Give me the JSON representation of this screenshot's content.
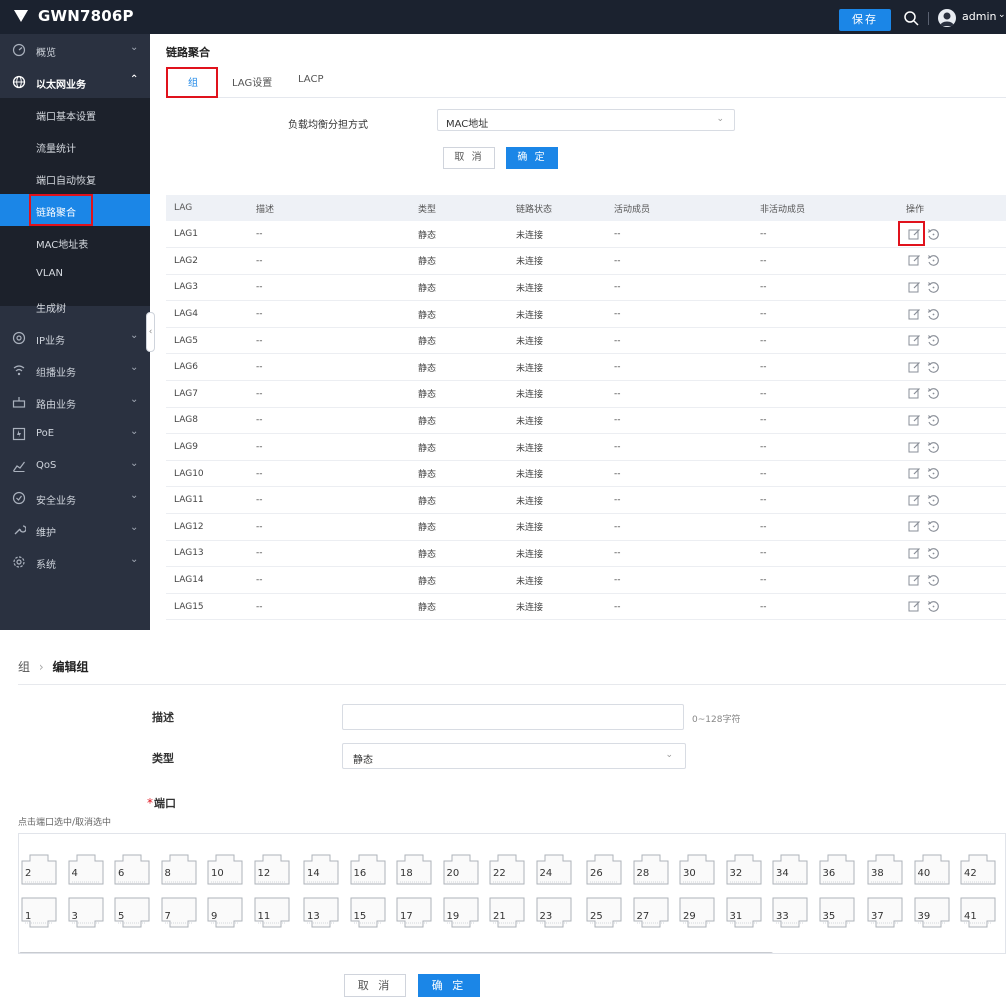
{
  "app": {
    "title": "GWN7806P",
    "save_label": "保存",
    "user": "admin"
  },
  "sidebar": {
    "items": [
      {
        "label": "概览",
        "icon": "dashboard-icon"
      },
      {
        "label": "以太网业务",
        "icon": "globe-icon"
      },
      {
        "label": "IP业务",
        "icon": "location-icon"
      },
      {
        "label": "组播业务",
        "icon": "multicast-icon"
      },
      {
        "label": "路由业务",
        "icon": "route-icon"
      },
      {
        "label": "PoE",
        "icon": "poe-icon"
      },
      {
        "label": "QoS",
        "icon": "chart-icon"
      },
      {
        "label": "安全业务",
        "icon": "shield-icon"
      },
      {
        "label": "维护",
        "icon": "wrench-icon"
      },
      {
        "label": "系统",
        "icon": "gear-icon"
      }
    ],
    "subitems": [
      "端口基本设置",
      "流量统计",
      "端口自动恢复",
      "链路聚合",
      "MAC地址表",
      "VLAN",
      "生成树"
    ],
    "active_subitem": "链路聚合"
  },
  "main": {
    "title": "链路聚合",
    "tabs": [
      "组",
      "LAG设置",
      "LACP"
    ],
    "active_tab": "组",
    "load_balance": {
      "label": "负载均衡分担方式",
      "value": "MAC地址"
    },
    "cancel_label": "取 消",
    "ok_label": "确 定"
  },
  "table": {
    "headers": [
      "LAG",
      "描述",
      "类型",
      "链路状态",
      "活动成员",
      "非活动成员",
      "操作"
    ],
    "rows": [
      [
        "LAG1",
        "--",
        "静态",
        "未连接",
        "--",
        "--"
      ],
      [
        "LAG2",
        "--",
        "静态",
        "未连接",
        "--",
        "--"
      ],
      [
        "LAG3",
        "--",
        "静态",
        "未连接",
        "--",
        "--"
      ],
      [
        "LAG4",
        "--",
        "静态",
        "未连接",
        "--",
        "--"
      ],
      [
        "LAG5",
        "--",
        "静态",
        "未连接",
        "--",
        "--"
      ],
      [
        "LAG6",
        "--",
        "静态",
        "未连接",
        "--",
        "--"
      ],
      [
        "LAG7",
        "--",
        "静态",
        "未连接",
        "--",
        "--"
      ],
      [
        "LAG8",
        "--",
        "静态",
        "未连接",
        "--",
        "--"
      ],
      [
        "LAG9",
        "--",
        "静态",
        "未连接",
        "--",
        "--"
      ],
      [
        "LAG10",
        "--",
        "静态",
        "未连接",
        "--",
        "--"
      ],
      [
        "LAG11",
        "--",
        "静态",
        "未连接",
        "--",
        "--"
      ],
      [
        "LAG12",
        "--",
        "静态",
        "未连接",
        "--",
        "--"
      ],
      [
        "LAG13",
        "--",
        "静态",
        "未连接",
        "--",
        "--"
      ],
      [
        "LAG14",
        "--",
        "静态",
        "未连接",
        "--",
        "--"
      ],
      [
        "LAG15",
        "--",
        "静态",
        "未连接",
        "--",
        "--"
      ]
    ]
  },
  "edit": {
    "breadcrumb_parent": "组",
    "breadcrumb_current": "编辑组",
    "desc_label": "描述",
    "desc_value": "",
    "desc_hint": "0~128字符",
    "type_label": "类型",
    "type_value": "静态",
    "port_label": "端口",
    "required_mark": "*",
    "port_hint": "点击端口选中/取消选中",
    "ports_top": [
      "2",
      "4",
      "6",
      "8",
      "10",
      "12",
      "14",
      "16",
      "18",
      "20",
      "22",
      "24",
      "26",
      "28",
      "30",
      "32",
      "34",
      "36",
      "38",
      "40",
      "42"
    ],
    "ports_bottom": [
      "1",
      "3",
      "5",
      "7",
      "9",
      "11",
      "13",
      "15",
      "17",
      "19",
      "21",
      "23",
      "25",
      "27",
      "29",
      "31",
      "33",
      "35",
      "37",
      "39",
      "41"
    ],
    "cancel_label": "取 消",
    "ok_label": "确 定"
  },
  "colors": {
    "accent": "#1b86e7",
    "topbar": "#1b222f",
    "sidebar": "#2a3140",
    "highlight": "#e0121c"
  }
}
